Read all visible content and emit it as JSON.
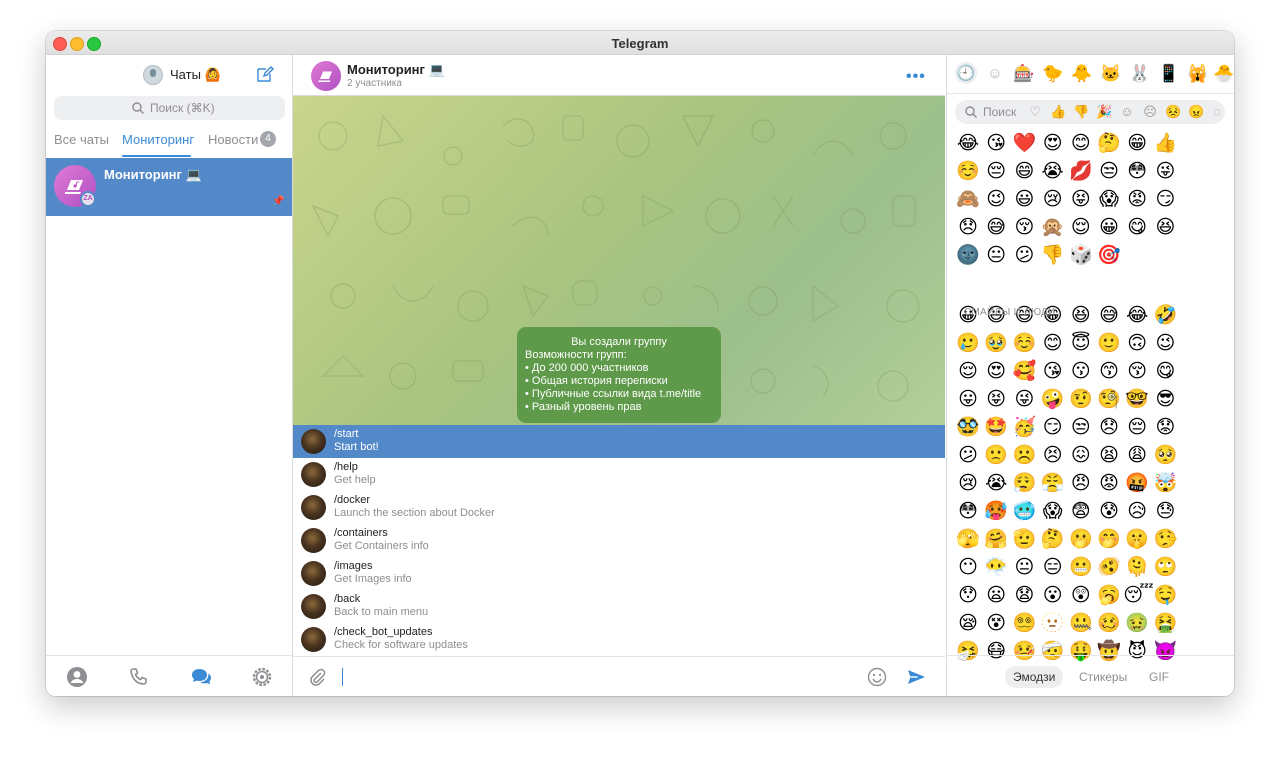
{
  "window": {
    "title": "Telegram"
  },
  "left": {
    "title": "Чаты 🙆",
    "search_placeholder": "Поиск (⌘K)",
    "folders": [
      {
        "label": "Все чаты"
      },
      {
        "label": "Мониторинг"
      },
      {
        "label": "Новости",
        "badge": "4"
      }
    ],
    "chat": {
      "name": "Мониторинг 💻",
      "avatar_mini": "ZA"
    }
  },
  "chat_header": {
    "title": "Мониторинг 💻",
    "subtitle": "2 участника"
  },
  "service_message": {
    "title": "Вы создали группу",
    "lines": [
      "Возможности групп:",
      "• До 200 000 участников",
      "• Общая история переписки",
      "• Публичные ссылки вида t.me/title",
      "• Разный уровень прав"
    ]
  },
  "commands": [
    {
      "name": "/start",
      "desc": "Start bot!"
    },
    {
      "name": "/help",
      "desc": "Get help"
    },
    {
      "name": "/docker",
      "desc": "Launch the section about Docker"
    },
    {
      "name": "/containers",
      "desc": "Get Containers info"
    },
    {
      "name": "/images",
      "desc": "Get Images info"
    },
    {
      "name": "/back",
      "desc": "Back to main menu"
    },
    {
      "name": "/check_bot_updates",
      "desc": "Check for software updates"
    }
  ],
  "emoji_panel": {
    "search_placeholder": "Поиск",
    "section_label": "СМАЙЛЫ И ЛЮДИ",
    "tabs": [
      "Эмодзи",
      "Стикеры",
      "GIF"
    ],
    "active_tab": "Эмодзи",
    "categories": [
      "🕘",
      "☺",
      "🎰",
      "🐤",
      "🐥",
      "🐱",
      "🐰",
      "📱",
      "🙀",
      "🐣"
    ],
    "recent_rows": [
      [
        "😂",
        "😘",
        "❤️",
        "😍",
        "😊",
        "🤔",
        "😁",
        "👍"
      ],
      [
        "☺️",
        "😔",
        "😄",
        "😭",
        "💋",
        "😒",
        "😳",
        "😜"
      ],
      [
        "🙈",
        "😉",
        "😃",
        "😢",
        "😝",
        "😱",
        "😡",
        "😏"
      ],
      [
        "😞",
        "😅",
        "😚",
        "🙊",
        "😌",
        "😀",
        "😋",
        "😆"
      ],
      [
        "🌚",
        "😐",
        "😕",
        "👎",
        "🎲",
        "🎯"
      ]
    ],
    "people_rows": [
      [
        "😀",
        "😃",
        "😄",
        "😁",
        "😆",
        "😅",
        "😂",
        "🤣"
      ],
      [
        "🥲",
        "🥹",
        "☺️",
        "😊",
        "😇",
        "🙂",
        "🙃",
        "😉"
      ],
      [
        "😌",
        "😍",
        "🥰",
        "😘",
        "😗",
        "😙",
        "😚",
        "😋"
      ],
      [
        "😛",
        "😝",
        "😜",
        "🤪",
        "🤨",
        "🧐",
        "🤓",
        "😎"
      ],
      [
        "🥸",
        "🤩",
        "🥳",
        "😏",
        "😒",
        "😞",
        "😔",
        "😟"
      ],
      [
        "😕",
        "🙁",
        "☹️",
        "😣",
        "😖",
        "😫",
        "😩",
        "🥺"
      ],
      [
        "😢",
        "😭",
        "😮‍💨",
        "😤",
        "😠",
        "😡",
        "🤬",
        "🤯"
      ],
      [
        "😳",
        "🥵",
        "🥶",
        "😱",
        "😨",
        "😰",
        "😥",
        "😓"
      ],
      [
        "🫣",
        "🤗",
        "🫡",
        "🤔",
        "🫢",
        "🤭",
        "🤫",
        "🤥"
      ],
      [
        "😶",
        "😶‍🌫️",
        "😐",
        "😑",
        "😬",
        "🫨",
        "🫠",
        "🙄"
      ],
      [
        "😯",
        "😦",
        "😧",
        "😮",
        "😲",
        "🥱",
        "😴",
        "🤤"
      ],
      [
        "😪",
        "😵",
        "😵‍💫",
        "🫥",
        "🤐",
        "🥴",
        "🤢",
        "🤮"
      ],
      [
        "🤧",
        "😷",
        "🤒",
        "🤕",
        "🤑",
        "🤠",
        "😈",
        "👿"
      ]
    ]
  }
}
